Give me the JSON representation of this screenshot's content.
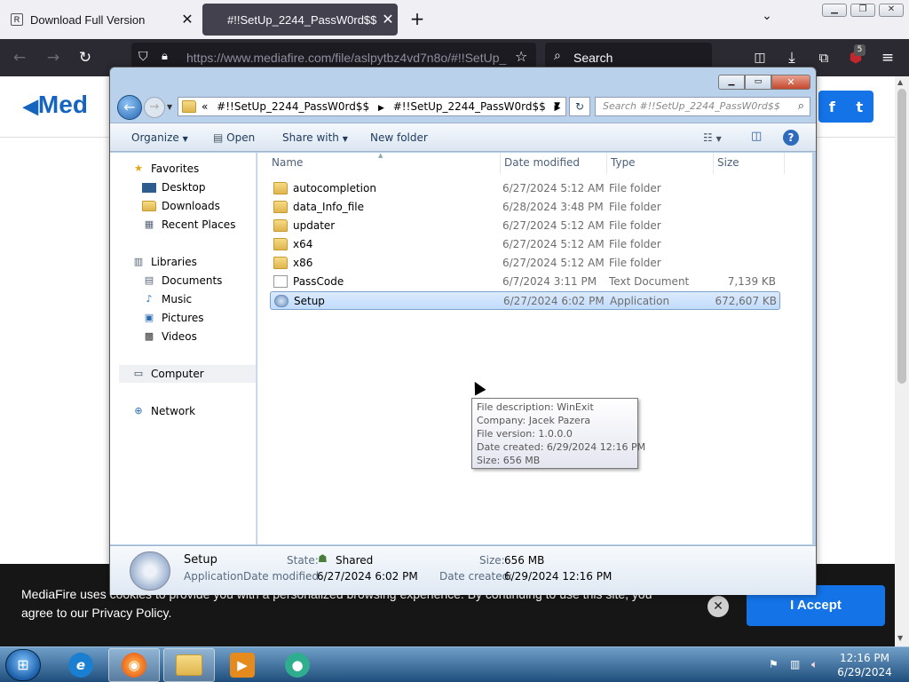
{
  "browser": {
    "tabs": [
      {
        "title": "Download Full Version",
        "favicon": "R"
      },
      {
        "title": "#!!SetUp_2244_PassW0rd$$"
      }
    ],
    "url": "https://www.mediafire.com/file/aslpytbz4vd7n8o/#!!SetUp_",
    "search_placeholder": "Search",
    "badge_count": "5"
  },
  "webpage": {
    "logo_text": "Med",
    "social": [
      "f",
      "t"
    ],
    "cookie_text": "MediaFire uses cookies to provide you with a personalized browsing experience. By continuing to use this site, you agree to our Privacy Policy.",
    "accept_label": "I Accept"
  },
  "explorer": {
    "address_prefix": "«",
    "address_parts": [
      "#!!SetUp_2244_PassW0rd$$",
      "#!!SetUp_2244_PassW0rd$$"
    ],
    "search_placeholder": "Search #!!SetUp_2244_PassW0rd$$",
    "toolbar": {
      "organize": "Organize",
      "open": "Open",
      "share_with": "Share with",
      "new_folder": "New folder"
    },
    "nav": {
      "favorites": "Favorites",
      "desktop": "Desktop",
      "downloads": "Downloads",
      "recent": "Recent Places",
      "libraries": "Libraries",
      "documents": "Documents",
      "music": "Music",
      "pictures": "Pictures",
      "videos": "Videos",
      "computer": "Computer",
      "network": "Network"
    },
    "columns": [
      "Name",
      "Date modified",
      "Type",
      "Size"
    ],
    "files": [
      {
        "name": "autocompletion",
        "date": "6/27/2024 5:12 AM",
        "type": "File folder",
        "size": "",
        "icon": "folder-icon"
      },
      {
        "name": "data_Info_file",
        "date": "6/28/2024 3:48 PM",
        "type": "File folder",
        "size": "",
        "icon": "folder-icon"
      },
      {
        "name": "updater",
        "date": "6/27/2024 5:12 AM",
        "type": "File folder",
        "size": "",
        "icon": "folder-icon"
      },
      {
        "name": "x64",
        "date": "6/27/2024 5:12 AM",
        "type": "File folder",
        "size": "",
        "icon": "folder-icon"
      },
      {
        "name": "x86",
        "date": "6/27/2024 5:12 AM",
        "type": "File folder",
        "size": "",
        "icon": "folder-icon"
      },
      {
        "name": "PassCode",
        "date": "6/7/2024 3:11 PM",
        "type": "Text Document",
        "size": "7,139 KB",
        "icon": "text-document-icon"
      },
      {
        "name": "Setup",
        "date": "6/27/2024 6:02 PM",
        "type": "Application",
        "size": "672,607 KB",
        "icon": "application-icon"
      }
    ],
    "tooltip": [
      "File description: WinExit",
      "Company: Jacek Pazera",
      "File version: 1.0.0.0",
      "Date created: 6/29/2024 12:16 PM",
      "Size: 656 MB"
    ],
    "details": {
      "name": "Setup",
      "kind": "Application",
      "state_label": "State:",
      "state_value": "Shared",
      "size_label": "Size:",
      "size_value": "656 MB",
      "modified_label": "Date modified:",
      "modified_value": "6/27/2024 6:02 PM",
      "created_label": "Date created:",
      "created_value": "6/29/2024 12:16 PM"
    }
  },
  "taskbar": {
    "time": "12:16 PM",
    "date": "6/29/2024"
  }
}
